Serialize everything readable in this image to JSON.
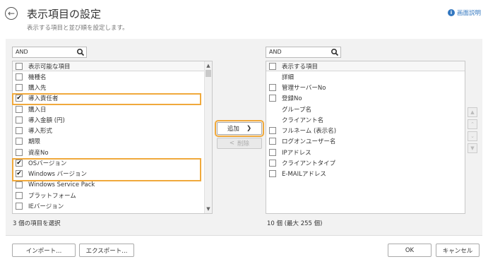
{
  "header": {
    "title": "表示項目の設定",
    "subtitle": "表示する項目と並び順を設定します。",
    "help_label": "画面説明"
  },
  "left": {
    "search_value": "AND",
    "header_label": "表示可能な項目",
    "items": [
      {
        "label": "機種名",
        "checked": false
      },
      {
        "label": "購入先",
        "checked": false
      },
      {
        "label": "導入責任者",
        "checked": true
      },
      {
        "label": "購入日",
        "checked": false
      },
      {
        "label": "導入金額 (円)",
        "checked": false
      },
      {
        "label": "導入形式",
        "checked": false
      },
      {
        "label": "期限",
        "checked": false
      },
      {
        "label": "資産No",
        "checked": false
      },
      {
        "label": "OSバージョン",
        "checked": true
      },
      {
        "label": "Windows バージョン",
        "checked": true
      },
      {
        "label": "Windows Service Pack",
        "checked": false
      },
      {
        "label": "プラットフォーム",
        "checked": false
      },
      {
        "label": "IEバージョン",
        "checked": false
      }
    ],
    "status": "3 個の項目を選択"
  },
  "middle": {
    "add_label": "追加",
    "remove_label": "削除"
  },
  "right": {
    "search_value": "AND",
    "header_label": "表示する項目",
    "items": [
      {
        "label": "詳細",
        "checkbox": false
      },
      {
        "label": "管理サーバーNo",
        "checkbox": true
      },
      {
        "label": "登録No",
        "checkbox": true
      },
      {
        "label": "グループ名",
        "checkbox": false
      },
      {
        "label": "クライアント名",
        "checkbox": false
      },
      {
        "label": "フルネーム (表示名)",
        "checkbox": true
      },
      {
        "label": "ログオンユーザー名",
        "checkbox": true
      },
      {
        "label": "IPアドレス",
        "checkbox": true
      },
      {
        "label": "クライアントタイプ",
        "checkbox": true
      },
      {
        "label": "E-MAILアドレス",
        "checkbox": true
      }
    ],
    "status": "10 個 (最大 255 個)"
  },
  "footer": {
    "import_label": "インポート...",
    "export_label": "エクスポート...",
    "ok_label": "OK",
    "cancel_label": "キャンセル"
  },
  "colors": {
    "highlight": "#f0a93c",
    "help": "#3277c0"
  }
}
